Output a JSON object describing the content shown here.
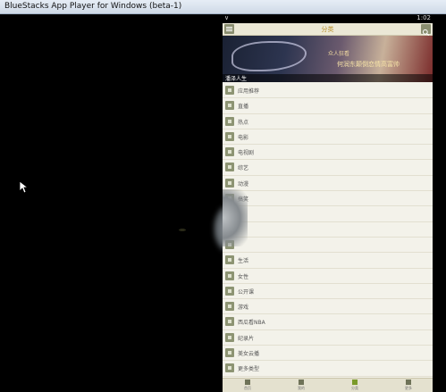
{
  "window": {
    "title": "BlueStacks App Player for Windows (beta-1)"
  },
  "status_bar": {
    "signal": "∨",
    "time": "1:02"
  },
  "app_header": {
    "title": "分类",
    "menu_icon": "menu-icon",
    "search_icon": "search-icon"
  },
  "banner": {
    "text_line1": "众人狂看",
    "text_line2": "何润东颠倒恋情高富帅",
    "caption": "潘泽人生",
    "page_count": 11,
    "active_page": 1
  },
  "categories": [
    {
      "label": "应用推荐",
      "icon": "apps-icon"
    },
    {
      "label": "直播",
      "icon": "live-icon"
    },
    {
      "label": "热点",
      "icon": "hot-icon"
    },
    {
      "label": "电影",
      "icon": "movie-icon"
    },
    {
      "label": "电视剧",
      "icon": "tv-icon"
    },
    {
      "label": "综艺",
      "icon": "variety-icon"
    },
    {
      "label": "动漫",
      "icon": "anime-icon"
    },
    {
      "label": "搞笑",
      "icon": "funny-icon"
    },
    {
      "label": "",
      "icon": "category-icon"
    },
    {
      "label": "",
      "icon": "category-icon"
    },
    {
      "label": "",
      "icon": "category-icon"
    },
    {
      "label": "生活",
      "icon": "life-icon"
    },
    {
      "label": "女性",
      "icon": "female-icon"
    },
    {
      "label": "公开课",
      "icon": "course-icon"
    },
    {
      "label": "游戏",
      "icon": "game-icon"
    },
    {
      "label": "西瓜看NBA",
      "icon": "nba-icon"
    },
    {
      "label": "纪录片",
      "icon": "documentary-icon"
    },
    {
      "label": "美女云播",
      "icon": "beauty-icon"
    },
    {
      "label": "更多类型",
      "icon": "more-icon"
    }
  ],
  "bottom_nav": [
    {
      "label": "首页",
      "icon": "home-icon"
    },
    {
      "label": "我的",
      "icon": "user-icon"
    },
    {
      "label": "分类",
      "icon": "category-icon",
      "active": true
    },
    {
      "label": "更多",
      "icon": "more-icon"
    }
  ]
}
